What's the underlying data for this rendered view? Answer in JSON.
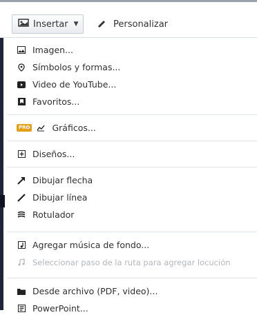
{
  "toolbar": {
    "insert_label": "Insertar",
    "personalize_label": "Personalizar"
  },
  "menu": {
    "group1": [
      {
        "label": "Imagen...",
        "icon": "image-icon"
      },
      {
        "label": "Símbolos y formas...",
        "icon": "location-pin-icon"
      },
      {
        "label": "Video de YouTube...",
        "icon": "play-icon"
      },
      {
        "label": "Favoritos...",
        "icon": "bookmark-icon"
      }
    ],
    "group2": [
      {
        "label": "Gráficos...",
        "icon": "chart-icon",
        "badge": "PRO"
      }
    ],
    "group3": [
      {
        "label": "Diseños...",
        "icon": "plus-box-icon"
      }
    ],
    "group4": [
      {
        "label": "Dibujar flecha",
        "icon": "arrow-icon"
      },
      {
        "label": "Dibujar línea",
        "icon": "line-icon"
      },
      {
        "label": "Rotulador",
        "icon": "marker-icon"
      }
    ],
    "group5": [
      {
        "label": "Agregar música de fondo...",
        "icon": "music-box-icon"
      },
      {
        "label": "Seleccionar paso de la ruta para agregar locución",
        "icon": "music-note-icon",
        "disabled": true
      }
    ],
    "group6": [
      {
        "label": "Desde archivo (PDF, video)...",
        "icon": "folder-icon"
      },
      {
        "label": "PowerPoint...",
        "icon": "powerpoint-icon"
      }
    ]
  }
}
